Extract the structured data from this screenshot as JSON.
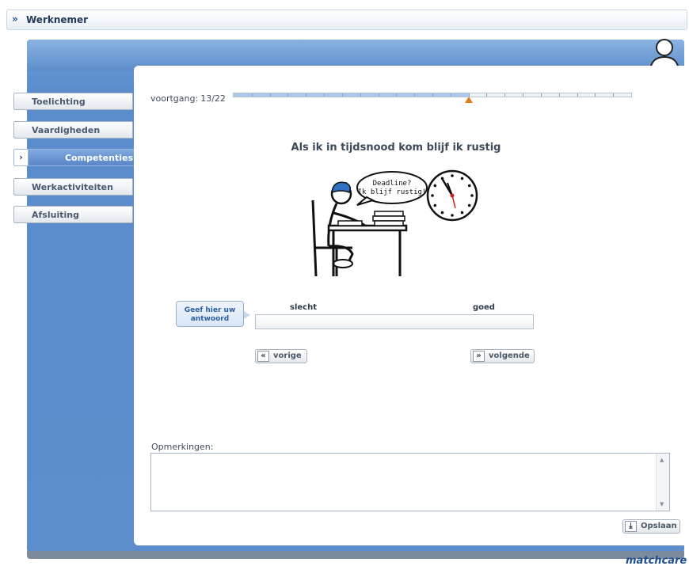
{
  "topbar": {
    "title": "Werknemer"
  },
  "nav": {
    "items": [
      {
        "label": "Toelichting"
      },
      {
        "label": "Vaardigheden"
      },
      {
        "label": "Competenties"
      },
      {
        "label": "Werkactiviteiten"
      },
      {
        "label": "Afsluiting"
      }
    ],
    "active_index": 2
  },
  "progress": {
    "label": "voortgang:",
    "value_text": "13/22",
    "current": 13,
    "total": 22
  },
  "question": {
    "text": "Als ik in tijdsnood kom blijf ik rustig"
  },
  "illustration": {
    "speech_line1": "Deadline?",
    "speech_line2": "Ik blijf rustig!"
  },
  "answer": {
    "hint_line1": "Geef hier uw",
    "hint_line2": "antwoord",
    "scale_low": "slecht",
    "scale_high": "goed"
  },
  "buttons": {
    "prev": "vorige",
    "next": "volgende",
    "save": "Opslaan"
  },
  "remarks": {
    "label": "Opmerkingen:",
    "value": ""
  },
  "brand": "matchcare",
  "colors": {
    "accent_blue": "#5d8dcb",
    "progress_fill": "#a9c8ea",
    "marker_orange": "#e07a1f"
  }
}
